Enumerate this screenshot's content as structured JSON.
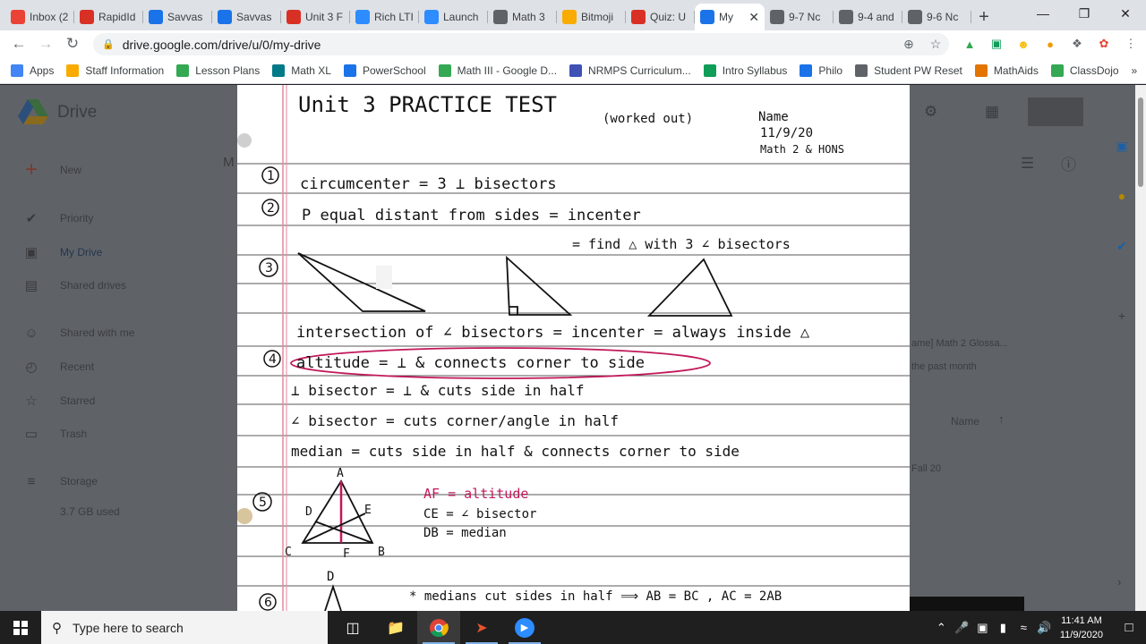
{
  "tabs": [
    {
      "title": "Inbox (2",
      "icon": "gmail-icon",
      "color": "#ea4335"
    },
    {
      "title": "RapidId",
      "icon": "rapididentity-icon",
      "color": "#d93025"
    },
    {
      "title": "Savvas",
      "icon": "savvas-icon",
      "color": "#1a73e8"
    },
    {
      "title": "Savvas",
      "icon": "savvas-icon",
      "color": "#1a73e8"
    },
    {
      "title": "Unit 3 F",
      "icon": "quizizz-icon",
      "color": "#d93025"
    },
    {
      "title": "Rich LTI",
      "icon": "zoom-icon",
      "color": "#2d8cff"
    },
    {
      "title": "Launch",
      "icon": "zoom-icon",
      "color": "#2d8cff"
    },
    {
      "title": "Math 3",
      "icon": "globe-icon",
      "color": "#5f6368"
    },
    {
      "title": "Bitmoji",
      "icon": "bitmoji-icon",
      "color": "#f9ab00"
    },
    {
      "title": "Quiz: U",
      "icon": "quizizz-icon",
      "color": "#d93025"
    },
    {
      "title": "My",
      "icon": "drive-icon",
      "color": "#1a73e8",
      "active": true
    },
    {
      "title": "9-7 Nc",
      "icon": "globe-icon",
      "color": "#5f6368"
    },
    {
      "title": "9-4 and",
      "icon": "globe-icon",
      "color": "#5f6368"
    },
    {
      "title": "9-6 Nc",
      "icon": "globe-icon",
      "color": "#5f6368"
    }
  ],
  "url": "drive.google.com/drive/u/0/my-drive",
  "bookmarks": [
    {
      "label": "Apps",
      "color": "#4285f4"
    },
    {
      "label": "Staff Information",
      "color": "#f9ab00"
    },
    {
      "label": "Lesson Plans",
      "color": "#34a853"
    },
    {
      "label": "Math XL",
      "color": "#007a87"
    },
    {
      "label": "PowerSchool",
      "color": "#1a73e8"
    },
    {
      "label": "Math III - Google D...",
      "color": "#34a853"
    },
    {
      "label": "NRMPS Curriculum...",
      "color": "#3f51b5"
    },
    {
      "label": "Intro Syllabus",
      "color": "#0f9d58"
    },
    {
      "label": "Philo",
      "color": "#1a73e8"
    },
    {
      "label": "Student PW Reset",
      "color": "#5f6368"
    },
    {
      "label": "MathAids",
      "color": "#e37400"
    },
    {
      "label": "ClassDojo",
      "color": "#34a853"
    }
  ],
  "drive": {
    "app_name": "Drive",
    "new_label": "New",
    "nav": [
      {
        "label": "Priority",
        "icon": "priority-icon"
      },
      {
        "label": "My Drive",
        "icon": "my-drive-icon"
      },
      {
        "label": "Shared drives",
        "icon": "shared-drives-icon"
      },
      {
        "label": "Shared with me",
        "icon": "shared-with-me-icon"
      },
      {
        "label": "Recent",
        "icon": "recent-icon"
      },
      {
        "label": "Starred",
        "icon": "starred-icon"
      },
      {
        "label": "Trash",
        "icon": "trash-icon"
      },
      {
        "label": "Storage",
        "icon": "storage-icon"
      }
    ],
    "storage_used": "3.7 GB used",
    "right_texts": {
      "file_name_fragment": "ame] Math 2 Glossa...",
      "file_time_fragment": "the past month",
      "sort_label": "Name",
      "folder_fragment": "Fall 20"
    }
  },
  "worksheet": {
    "title": "Unit 3   PRACTICE TEST",
    "subtitle": "(worked out)",
    "name_label": "Name",
    "date": "11/9/20",
    "class": "Math 2 & HONS",
    "q1": "circumcenter = 3 ⊥ bisectors",
    "q2a": "P  equal distant  from sides  = incenter",
    "q2b": "= find  △ with 3 ∠ bisectors",
    "q3": "intersection of ∠ bisectors = incenter = always inside △",
    "q4a": "altitude  =  ⊥  &  connects  corner  to side",
    "q4b": "⊥ bisector  =  ⊥  &  cuts  side  in  half",
    "q4c": "∠ bisector  =   cuts  corner/angle  in half",
    "q4d": "median    =  cuts side in half & connects  corner  to side",
    "q5_af": "AF = altitude",
    "q5_ce": "CE = ∠ bisector",
    "q5_db": "DB = median",
    "q6": "* medians cut sides in half ⟹  AB = BC ,  AC = 2AB",
    "numbers": [
      "1",
      "2",
      "3",
      "4",
      "5",
      "6"
    ],
    "labels": {
      "A": "A",
      "B": "B",
      "C": "C",
      "D": "D",
      "E": "E",
      "F": "F",
      "D6": "D"
    }
  },
  "taskbar": {
    "search_placeholder": "Type here to search",
    "time": "11:41 AM",
    "date": "11/9/2020"
  }
}
